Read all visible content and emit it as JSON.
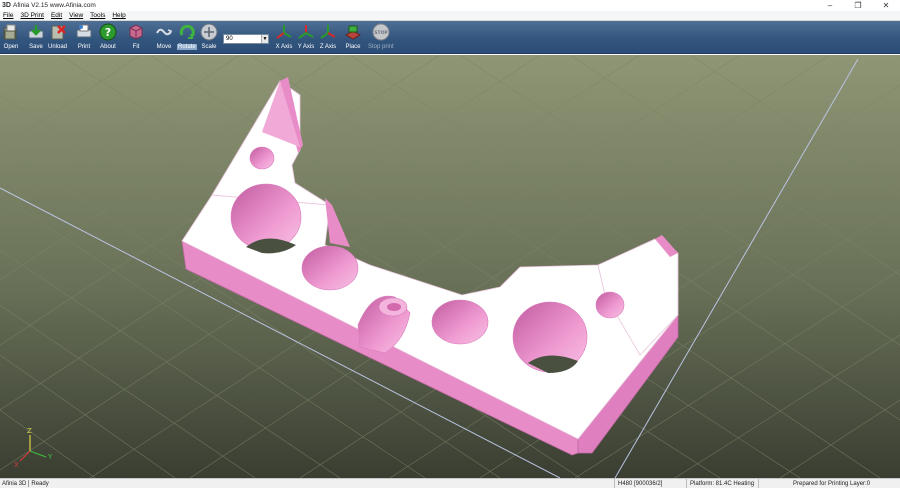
{
  "window": {
    "icon_text": "3D",
    "title": "Afinia  V2.15  www.Afinia.com",
    "minimize": "–",
    "restore": "❐",
    "close": "✕"
  },
  "menu": [
    "File",
    "3D Print",
    "Edit",
    "View",
    "Tools",
    "Help"
  ],
  "toolbar": {
    "open": "Open",
    "save": "Save",
    "unload": "Unload",
    "print": "Print",
    "about": "About",
    "fit": "Fit",
    "move": "Move",
    "rotate": "Rotate",
    "scale": "Scale",
    "angle_value": "90",
    "x_axis": "X Axis",
    "y_axis": "Y Axis",
    "z_axis": "Z Axis",
    "place": "Place",
    "stop_print": "Stop print",
    "stop_icon_text": "STOP"
  },
  "axis_gizmo": {
    "z": "Z",
    "y": "Y",
    "x": "X"
  },
  "status": {
    "app": "Afinia 3D",
    "state": "Ready",
    "printer": "H480 [900036/2]",
    "platform": "Platform: 81.4C Heating",
    "job": "Prepared for Printing Layer:0"
  },
  "colors": {
    "toolbar": "#33567f",
    "viewport_top": "#8f9675",
    "viewport_bottom": "#3a3e32",
    "model_face": "#ffffff",
    "model_side": "#e88cc8"
  }
}
